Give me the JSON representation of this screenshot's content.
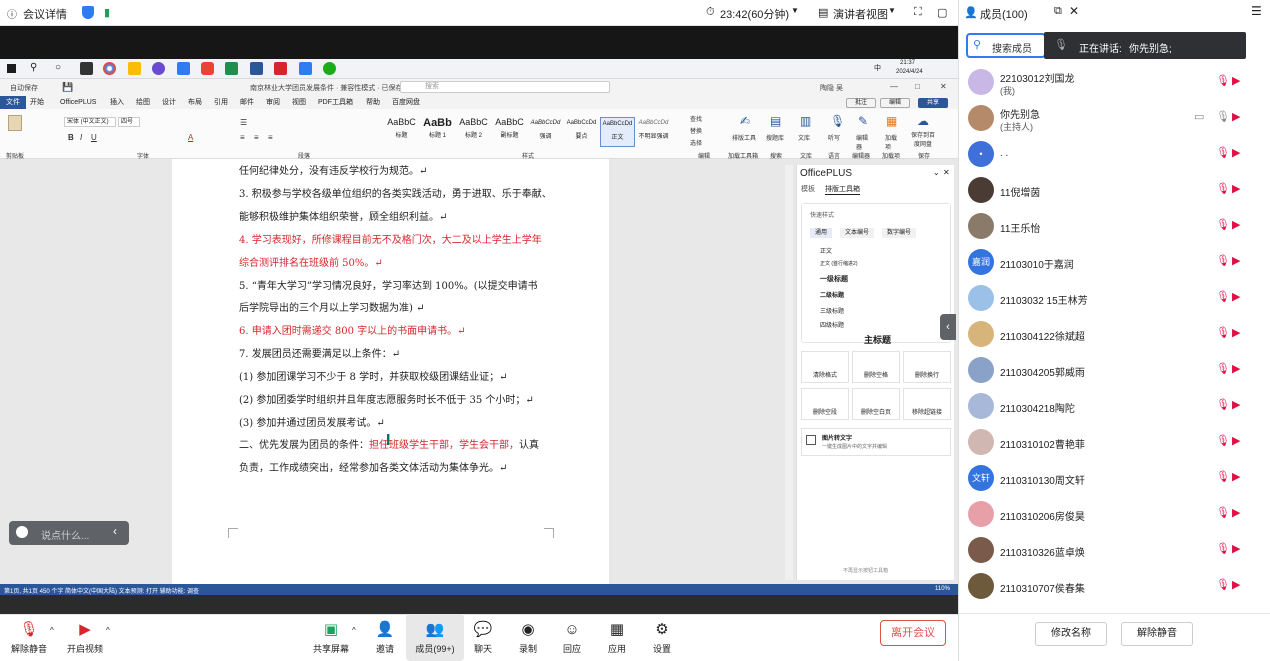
{
  "topbar": {
    "meeting_details": "会议详情",
    "clock": "23:42(60分钟)",
    "view_mode": "演讲者视图",
    "members_title": "成员(100)"
  },
  "speaking": {
    "label": "正在讲话:",
    "name": "你先别急;"
  },
  "member_search": {
    "placeholder": "搜索成员"
  },
  "taskbar": {
    "time": "21:37",
    "date": "2024/4/24",
    "lang": "中"
  },
  "word": {
    "title": "南京林业大学团员发展条件 · 兼容性模式 · 已保存",
    "search_placeholder": "搜索",
    "user": "陶隐 吴",
    "tabs": [
      "文件",
      "开始",
      "OfficePLUS",
      "插入",
      "绘图",
      "设计",
      "布局",
      "引用",
      "邮件",
      "审阅",
      "视图",
      "PDF工具箱",
      "帮助",
      "百度网盘"
    ],
    "active_tab": "开始",
    "buttons": {
      "comment": "批注",
      "edit": "编辑",
      "share": "共享"
    },
    "font_name": "宋体 (中文正文)",
    "font_size": "四号",
    "style_previews": [
      "AaBbC",
      "AaBb",
      "AaBbC",
      "AaBbC",
      "AaBbCcDd",
      "AaBbCcDd",
      "AaBbCcDd",
      "AaBbCcDd"
    ],
    "styles": [
      "标题",
      "标题 1",
      "标题 2",
      "副标题",
      "强调",
      "要点",
      "正文",
      "不明显强调"
    ],
    "groups": [
      "剪贴板",
      "字体",
      "段落",
      "样式",
      "编辑",
      "加载工具箱",
      "搜索",
      "文库",
      "语言",
      "编辑器",
      "加载项",
      "保存"
    ],
    "right_tools": [
      "查找",
      "替换",
      "选择",
      "排版工具",
      "搜题库",
      "文库",
      "听写",
      "编辑器",
      "加载项",
      "保存到百度网盘"
    ],
    "status_left": "第1页, 共1页  450 个字  简体中文(中国大陆)  文本预测: 打开  辅助功能: 调查",
    "zoom": "110%",
    "paragraphs": [
      {
        "text": "任何纪律处分，没有违反学校行为规范。↵",
        "red": false
      },
      {
        "text": "3. 积极参与学校各级单位组织的各类实践活动，勇于进取、乐于奉献、",
        "red": false
      },
      {
        "text": "能够积极维护集体组织荣誉，顾全组织利益。↵",
        "red": false
      },
      {
        "text": "4. 学习表现好，所修课程目前无不及格门次，大二及以上学生上学年",
        "red": true
      },
      {
        "text": "综合测评排名在班级前 50%。↵",
        "red": true
      },
      {
        "text": "5. “青年大学习”学习情况良好，学习率达到 100%。(以提交申请书",
        "red": false
      },
      {
        "text": "后学院导出的三个月以上学习数据为准) ↵",
        "red": false
      },
      {
        "text": "6. 申请入团时需递交 800 字以上的书面申请书。↵",
        "red": true
      },
      {
        "text": "7. 发展团员还需要满足以上条件：↵",
        "red": false
      },
      {
        "text": "(1) 参加团课学习不少于 8 学时，并获取校级团课结业证；↵",
        "red": false
      },
      {
        "text": "(2) 参加团委学时组织并且年度志愿服务时长不低于 35 个小时；↵",
        "red": false
      },
      {
        "text": "(3) 参加并通过团员发展考试。↵",
        "red": false
      },
      {
        "text": "负责，工作成绩突出，经常参加各类文体活动为集体争光。↵",
        "red": false
      }
    ],
    "line_two_a": "二、优先发展为团员的条件：",
    "line_two_b": "担任班级学生干部，学生会干部，",
    "line_two_c": "认真"
  },
  "officeplus": {
    "title": "OfficePLUS",
    "tabs": [
      "模板",
      "排版工具箱"
    ],
    "quick_styles": "快速样式",
    "chips": [
      "通用",
      "文本编号",
      "数字编号"
    ],
    "styles": [
      "正文",
      "正文 (首行缩进2)",
      "一级标题",
      "二级标题",
      "三级标题",
      "四级标题",
      "主标题"
    ],
    "tools": [
      "清除格式",
      "删除空格",
      "删除换行",
      "删除空段",
      "删除空白页",
      "移除超链接"
    ],
    "image_text_title": "图片转文字",
    "image_text_desc": "一键生成图片中的文字并编辑",
    "footer": "不再显示按钮工具箱"
  },
  "chat_input": {
    "placeholder": "说点什么..."
  },
  "meeting_toolbar": [
    {
      "label": "解除静音",
      "icon": "mic-muted-icon"
    },
    {
      "label": "开启视频",
      "icon": "camera-off-icon"
    },
    {
      "label": "共享屏幕",
      "icon": "share-screen-icon"
    },
    {
      "label": "邀请",
      "icon": "invite-icon"
    },
    {
      "label": "成员(99+)",
      "icon": "members-icon"
    },
    {
      "label": "聊天",
      "icon": "chat-icon"
    },
    {
      "label": "录制",
      "icon": "record-icon"
    },
    {
      "label": "回应",
      "icon": "reaction-icon"
    },
    {
      "label": "应用",
      "icon": "apps-icon"
    },
    {
      "label": "设置",
      "icon": "settings-icon"
    }
  ],
  "leave_button": "离开会议",
  "members": [
    {
      "name": "22103012刘国龙",
      "sub": "(我)",
      "color": "#c9b7e6",
      "initial": ""
    },
    {
      "name": "你先别急",
      "sub": "(主持人)",
      "color": "#b58a6b",
      "initial": ""
    },
    {
      "name": ". .",
      "sub": "",
      "color": "#3f6fd8",
      "initial": "•"
    },
    {
      "name": "11倪增茵",
      "sub": "",
      "color": "#4a3b34",
      "initial": ""
    },
    {
      "name": "11王乐怡",
      "sub": "",
      "color": "#8a7a6a",
      "initial": ""
    },
    {
      "name": "21103010于嘉润",
      "sub": "",
      "color": "#3474e0",
      "initial": "嘉润"
    },
    {
      "name": "21103032 15王林芳",
      "sub": "",
      "color": "#9cc1e8",
      "initial": ""
    },
    {
      "name": "2110304122徐斌超",
      "sub": "",
      "color": "#d7b47a",
      "initial": ""
    },
    {
      "name": "2110304205郭威雨",
      "sub": "",
      "color": "#8aa2c8",
      "initial": ""
    },
    {
      "name": "2110304218陶陀",
      "sub": "",
      "color": "#a8b8d8",
      "initial": ""
    },
    {
      "name": "2110310102曹艳菲",
      "sub": "",
      "color": "#d0b7b2",
      "initial": ""
    },
    {
      "name": "2110310130周文轩",
      "sub": "",
      "color": "#3474e0",
      "initial": "文轩"
    },
    {
      "name": "2110310206房俊昊",
      "sub": "",
      "color": "#e8a0a8",
      "initial": ""
    },
    {
      "name": "2110310326蓝卓焕",
      "sub": "",
      "color": "#7a5a4a",
      "initial": ""
    },
    {
      "name": "2110310707侯春集",
      "sub": "",
      "color": "#6d5a3d",
      "initial": ""
    }
  ],
  "member_actions": {
    "rename": "修改名称",
    "unmute": "解除静音"
  }
}
